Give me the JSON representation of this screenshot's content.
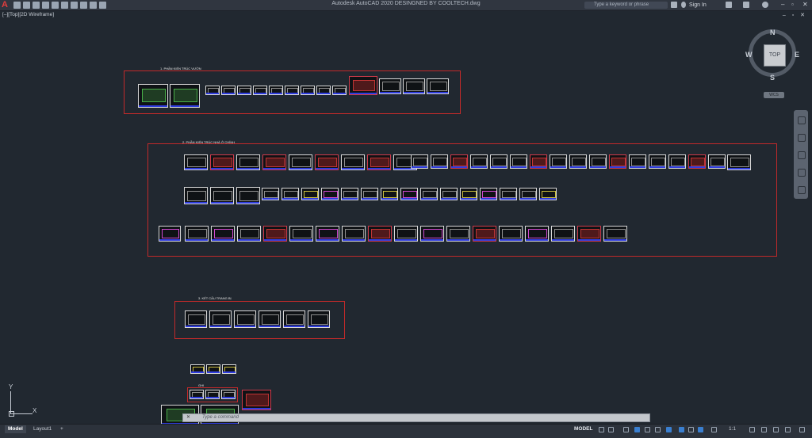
{
  "titlebar": {
    "logo": "A",
    "title": "Autodesk AutoCAD 2020    DESINGNED BY COOLTECH.dwg",
    "search_placeholder": "Type a keyword or phrase",
    "sign_in": "Sign In"
  },
  "window_controls": {
    "minimize": "–",
    "restore": "▫",
    "close": "✕"
  },
  "viewport": {
    "label": "[–][Top][2D Wireframe]",
    "controls": "– ▫ ✕"
  },
  "drawing": {
    "groups": [
      {
        "title": "1. PHẦN KIẾN TRÚC VƯỜN"
      },
      {
        "title": "2. PHẦN KIẾN TRÚC NHÀ Ở CHÍNH"
      },
      {
        "title": "3. KẾT CẤU TRANG BỊ"
      }
    ],
    "misc_label": "GHI"
  },
  "viewcube": {
    "north": "N",
    "south": "S",
    "east": "E",
    "west": "W",
    "face": "TOP",
    "ucs": "WCS"
  },
  "ucs_icon": {
    "x": "X",
    "y": "Y"
  },
  "command_line": {
    "close_symbol": "✕",
    "placeholder": "Type a command"
  },
  "statusbar": {
    "tabs": [
      "Model",
      "Layout1",
      "+"
    ],
    "model_label": "MODEL",
    "scale": "1:1"
  }
}
